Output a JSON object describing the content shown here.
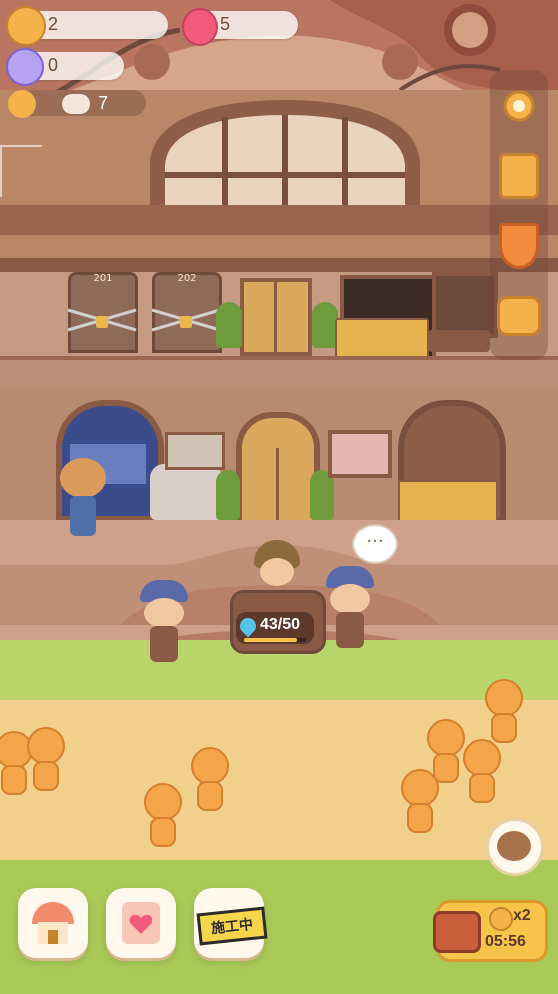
{
  "resources": {
    "cookie_count": "2",
    "candy_count": "5",
    "gem_count": "0",
    "fan_count": "7"
  },
  "building": {
    "room_201": "201",
    "room_202": "202"
  },
  "counter": {
    "progress_text": "43/50",
    "progress_value": 0.86
  },
  "npc_speech": {
    "text": "···"
  },
  "bottom_bar": {
    "construction_label": "施工中",
    "ad_multiplier": "x2",
    "ad_timer": "05:56"
  },
  "colors": {
    "wall": "#b98668",
    "floor": "#caa08a",
    "grass": "#b9d46a",
    "dirt": "#f0d08a",
    "accent": "#f7b23b"
  },
  "icons": {
    "settings": "gear-icon",
    "quest": "quest-card-icon",
    "rank": "medal-icon",
    "bag": "backpack-icon"
  }
}
